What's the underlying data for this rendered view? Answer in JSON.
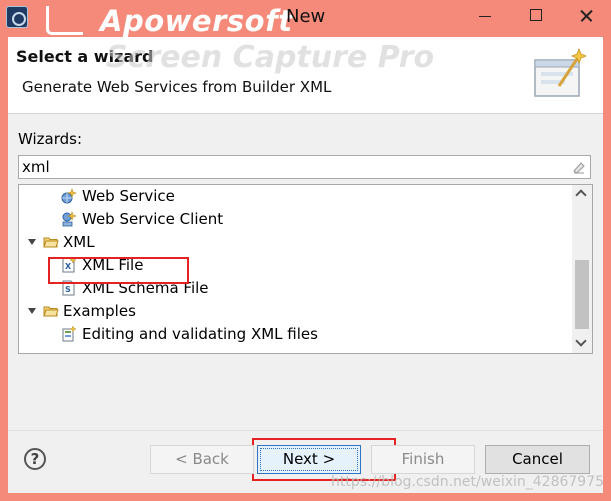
{
  "window": {
    "title": "New",
    "watermark": "Apowersoft",
    "watermark_overlay": "Screen Capture Pro"
  },
  "header": {
    "title": "Select a wizard",
    "description": "Generate Web Services from Builder XML"
  },
  "wizards": {
    "label": "Wizards:",
    "filter_value": "xml"
  },
  "tree": {
    "items": [
      {
        "label": "Web Service",
        "icon": "web-service-icon",
        "expanded": false
      },
      {
        "label": "Web Service Client",
        "icon": "web-service-client-icon",
        "expanded": false
      },
      {
        "label": "XML",
        "icon": "folder-icon",
        "expanded": true
      },
      {
        "label": "XML File",
        "icon": "xml-file-icon",
        "expanded": false
      },
      {
        "label": "XML Schema File",
        "icon": "xml-schema-icon",
        "expanded": false
      },
      {
        "label": "Examples",
        "icon": "folder-icon",
        "expanded": true
      },
      {
        "label": "Editing and validating XML files",
        "icon": "example-icon",
        "expanded": false
      }
    ]
  },
  "buttons": {
    "help": "?",
    "back": "< Back",
    "next": "Next >",
    "finish": "Finish",
    "cancel": "Cancel"
  },
  "footer": {
    "watermark_url": "https://blog.csdn.net/weixin_42867975"
  },
  "colors": {
    "title_bar": "#f58a7a",
    "highlight": "#e52222",
    "default_button_border": "#2e74c6"
  }
}
